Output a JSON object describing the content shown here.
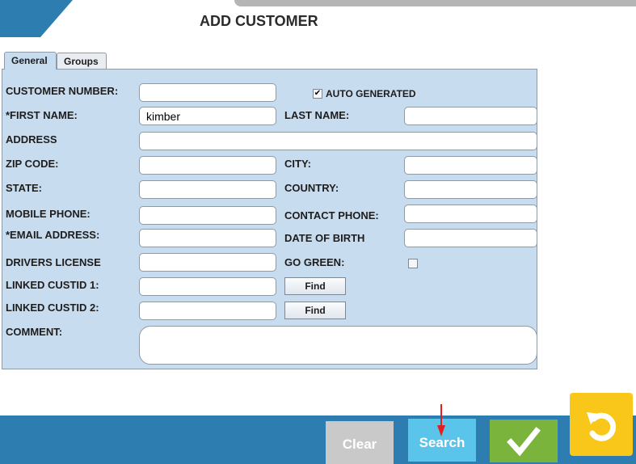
{
  "page": {
    "title": "ADD CUSTOMER"
  },
  "tabs": [
    {
      "label": "General",
      "active": true
    },
    {
      "label": "Groups",
      "active": false
    }
  ],
  "form": {
    "customer_number": {
      "label": "CUSTOMER NUMBER:",
      "value": ""
    },
    "auto_generated": {
      "label": "AUTO GENERATED",
      "checked": true,
      "mark": "✔"
    },
    "first_name": {
      "label": "*FIRST NAME:",
      "value": "kimber"
    },
    "last_name": {
      "label": "LAST NAME:",
      "value": ""
    },
    "address": {
      "label": "ADDRESS",
      "value": ""
    },
    "zip_code": {
      "label": "ZIP CODE:",
      "value": ""
    },
    "city": {
      "label": "CITY:",
      "value": ""
    },
    "state": {
      "label": "STATE:",
      "value": ""
    },
    "country": {
      "label": "COUNTRY:",
      "value": ""
    },
    "mobile_phone": {
      "label": "MOBILE PHONE:",
      "value": ""
    },
    "contact_phone": {
      "label": "CONTACT PHONE:",
      "value": ""
    },
    "email": {
      "label": "*EMAIL ADDRESS:",
      "value": ""
    },
    "date_of_birth": {
      "label": "DATE OF BIRTH",
      "value": ""
    },
    "drivers_license": {
      "label": "DRIVERS LICENSE",
      "value": ""
    },
    "go_green": {
      "label": "GO GREEN:",
      "checked": false
    },
    "linked_custid_1": {
      "label": "LINKED CUSTID 1:",
      "value": "",
      "find_label": "Find"
    },
    "linked_custid_2": {
      "label": "LINKED CUSTID 2:",
      "value": "",
      "find_label": "Find"
    },
    "comment": {
      "label": "COMMENT:",
      "value": ""
    }
  },
  "actions": {
    "clear_label": "Clear",
    "search_label": "Search",
    "confirm_icon": "checkmark-icon",
    "back_icon": "undo-arrow-icon"
  },
  "colors": {
    "panel_bg": "#c8dcf0",
    "bottom_bar": "#2e7db0",
    "clear_button": "#c9c9c9",
    "search_button": "#5bc4ea",
    "confirm_button": "#7ab43c",
    "back_button": "#f8c71a"
  }
}
